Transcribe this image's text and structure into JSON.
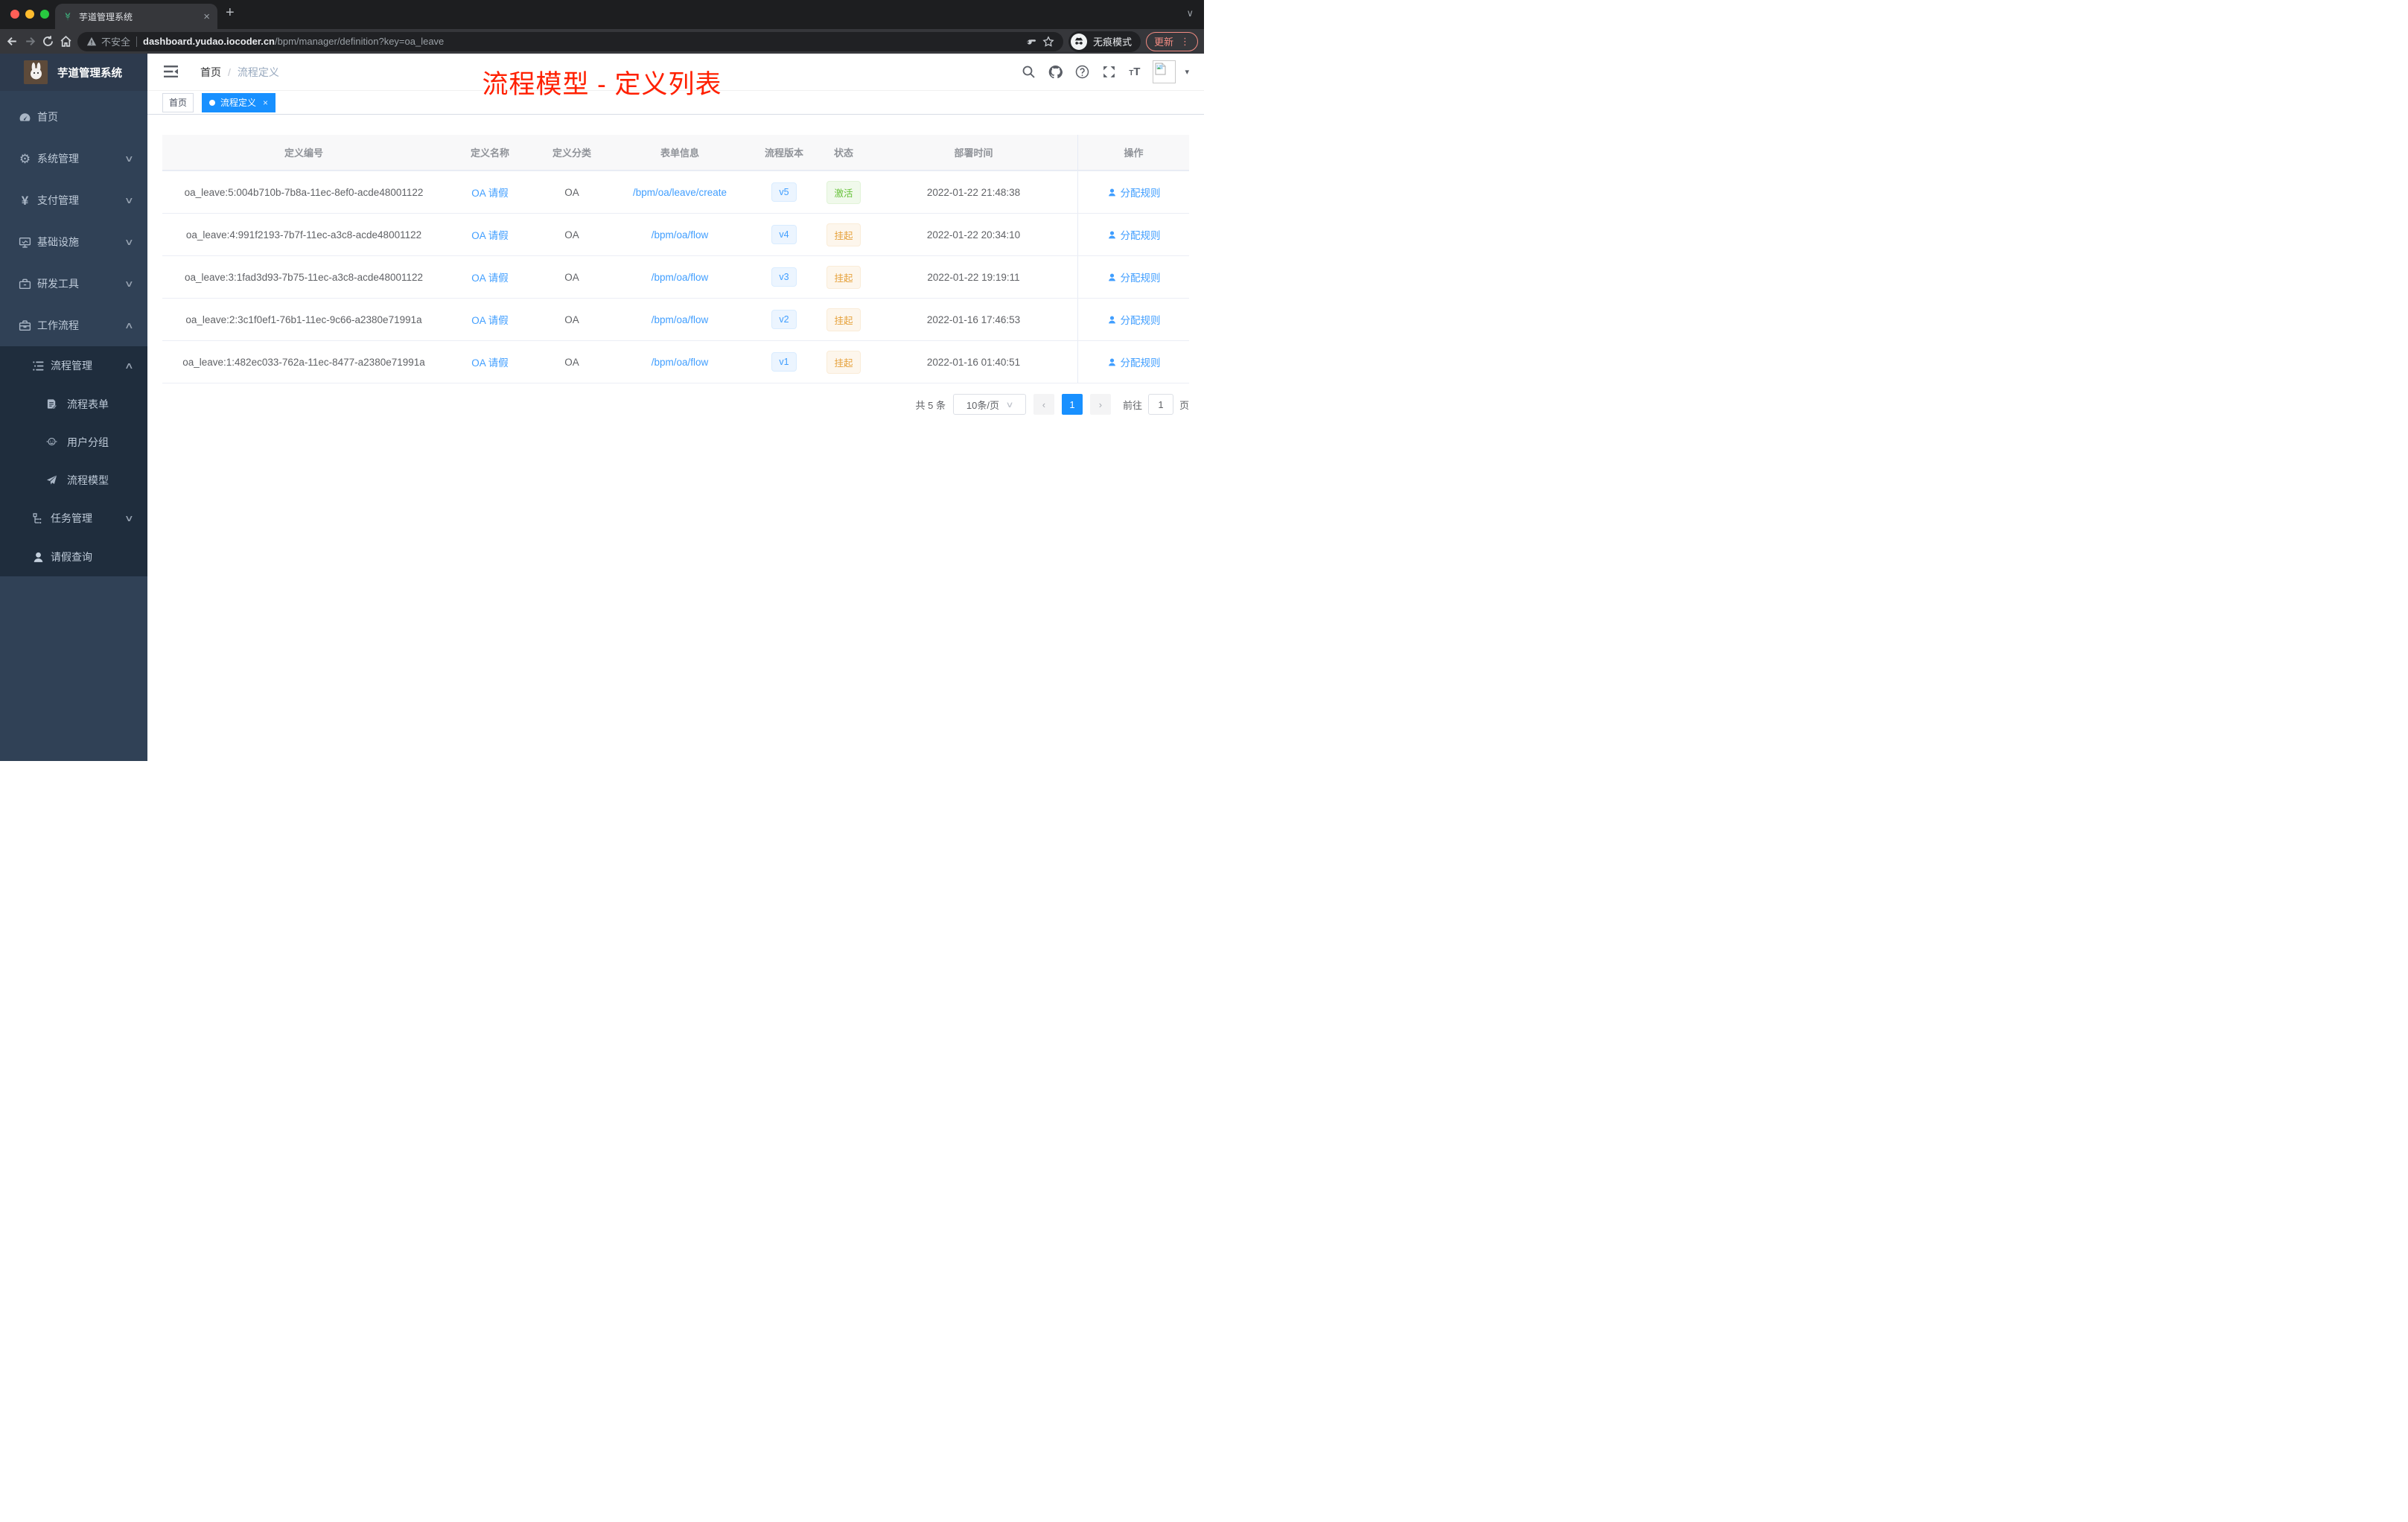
{
  "browser": {
    "tab_title": "芋道管理系统",
    "security_label": "不安全",
    "url_domain": "dashboard.yudao.iocoder.cn",
    "url_path": "/bpm/manager/definition?key=oa_leave",
    "incognito_label": "无痕模式",
    "update_label": "更新",
    "traffic_lights": {
      "close": "#ff5f57",
      "minimize": "#febc2e",
      "zoom": "#28c840"
    }
  },
  "sidebar": {
    "logo_title": "芋道管理系统",
    "items": [
      {
        "label": "首页",
        "icon": "dashboard-icon"
      },
      {
        "label": "系统管理",
        "icon": "gear-icon"
      },
      {
        "label": "支付管理",
        "icon": "yen-icon"
      },
      {
        "label": "基础设施",
        "icon": "monitor-icon"
      },
      {
        "label": "研发工具",
        "icon": "toolbox-icon"
      },
      {
        "label": "工作流程",
        "icon": "briefcase-icon"
      },
      {
        "label": "流程管理",
        "icon": "list-icon"
      },
      {
        "label": "流程表单",
        "icon": "form-icon"
      },
      {
        "label": "用户分组",
        "icon": "user-group-icon"
      },
      {
        "label": "流程模型",
        "icon": "paper-plane-icon"
      },
      {
        "label": "任务管理",
        "icon": "tree-icon"
      },
      {
        "label": "请假查询",
        "icon": "user-icon"
      }
    ]
  },
  "header": {
    "breadcrumb_home": "首页",
    "breadcrumb_separator": "/",
    "breadcrumb_current": "流程定义",
    "overlay_title": "流程模型 - 定义列表"
  },
  "tags": {
    "home": "首页",
    "active": "流程定义"
  },
  "table": {
    "columns": [
      "定义编号",
      "定义名称",
      "定义分类",
      "表单信息",
      "流程版本",
      "状态",
      "部署时间",
      "操作"
    ],
    "action_label": "分配规则",
    "rows": [
      {
        "id": "oa_leave:5:004b710b-7b8a-11ec-8ef0-acde48001122",
        "name": "OA 请假",
        "category": "OA",
        "form": "/bpm/oa/leave/create",
        "version": "v5",
        "status": "激活",
        "status_type": "success",
        "deployed": "2022-01-22 21:48:38"
      },
      {
        "id": "oa_leave:4:991f2193-7b7f-11ec-a3c8-acde48001122",
        "name": "OA 请假",
        "category": "OA",
        "form": "/bpm/oa/flow",
        "version": "v4",
        "status": "挂起",
        "status_type": "warning",
        "deployed": "2022-01-22 20:34:10"
      },
      {
        "id": "oa_leave:3:1fad3d93-7b75-11ec-a3c8-acde48001122",
        "name": "OA 请假",
        "category": "OA",
        "form": "/bpm/oa/flow",
        "version": "v3",
        "status": "挂起",
        "status_type": "warning",
        "deployed": "2022-01-22 19:19:11"
      },
      {
        "id": "oa_leave:2:3c1f0ef1-76b1-11ec-9c66-a2380e71991a",
        "name": "OA 请假",
        "category": "OA",
        "form": "/bpm/oa/flow",
        "version": "v2",
        "status": "挂起",
        "status_type": "warning",
        "deployed": "2022-01-16 17:46:53"
      },
      {
        "id": "oa_leave:1:482ec033-762a-11ec-8477-a2380e71991a",
        "name": "OA 请假",
        "category": "OA",
        "form": "/bpm/oa/flow",
        "version": "v1",
        "status": "挂起",
        "status_type": "warning",
        "deployed": "2022-01-16 01:40:51"
      }
    ]
  },
  "pagination": {
    "total": "共 5 条",
    "page_size": "10条/页",
    "page": "1",
    "page_input": "1",
    "goto_label": "前往",
    "page_unit": "页"
  },
  "icons": {
    "close": "×",
    "plus": "+",
    "kebab": "⋮",
    "chevron_down": "∨",
    "chevron_up": "∧",
    "caret_down": "▾",
    "star": "☆",
    "gear": "⚙",
    "yen": "¥"
  },
  "colors": {
    "theme_blue": "#1890ff",
    "link_blue": "#409eff",
    "success_green": "#67c23a",
    "warning_orange": "#e6a23c",
    "overlay_red": "#ff2000",
    "sidebar_bg": "#304156",
    "submenu_bg": "#1f2d3d"
  }
}
